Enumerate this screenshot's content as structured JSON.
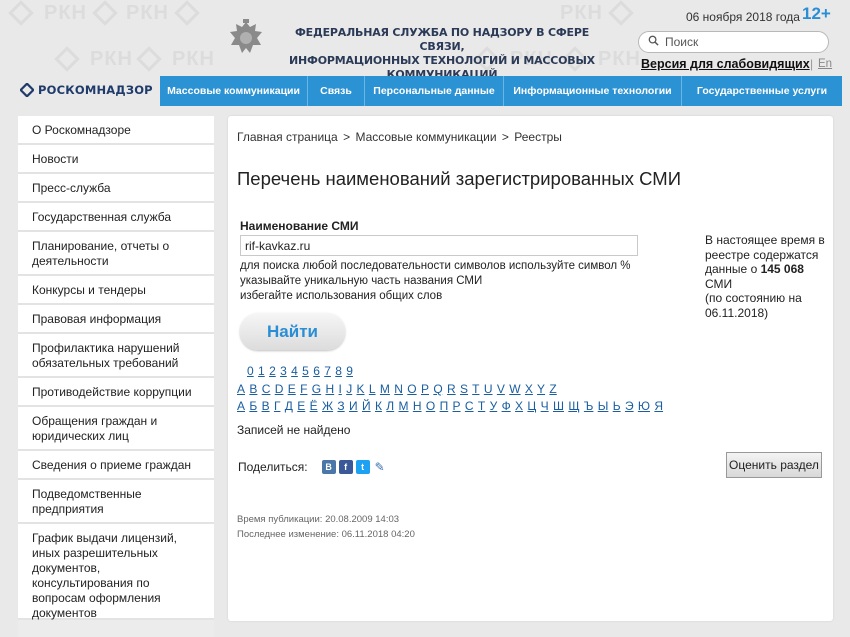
{
  "header": {
    "agency_line1": "ФЕДЕРАЛЬНАЯ СЛУЖБА ПО НАДЗОРУ В СФЕРЕ СВЯЗИ,",
    "agency_line2": "ИНФОРМАЦИОННЫХ ТЕХНОЛОГИЙ И МАССОВЫХ КОММУНИКАЦИЙ",
    "date": "06 ноября 2018 года",
    "age_rating": "12+",
    "search_placeholder": "Поиск",
    "accessibility_link": "Версия для слабовидящих",
    "separator": "|",
    "lang_link": "En",
    "logo_text": "РОСКОМНАДЗОР",
    "watermark": "РКН"
  },
  "nav": [
    {
      "label": "Массовые коммуникации"
    },
    {
      "label": "Связь"
    },
    {
      "label": "Персональные данные"
    },
    {
      "label": "Информационные технологии"
    },
    {
      "label": "Государственные услуги"
    }
  ],
  "sidebar": [
    {
      "label": "О Роскомнадзоре"
    },
    {
      "label": "Новости"
    },
    {
      "label": "Пресс-служба"
    },
    {
      "label": "Государственная служба"
    },
    {
      "label": "Планирование, отчеты о деятельности"
    },
    {
      "label": "Конкурсы и тендеры"
    },
    {
      "label": "Правовая информация"
    },
    {
      "label": "Профилактика нарушений обязательных требований"
    },
    {
      "label": "Противодействие коррупции"
    },
    {
      "label": "Обращения граждан и юридических лиц"
    },
    {
      "label": "Сведения о приеме граждан"
    },
    {
      "label": "Подведомственные предприятия"
    },
    {
      "label": "График выдачи лицензий, иных разрешительных документов, консультирования по вопросам оформления документов"
    }
  ],
  "main": {
    "breadcrumb": [
      "Главная страница",
      "Массовые коммуникации",
      "Реестры"
    ],
    "breadcrumb_sep": ">",
    "title": "Перечень наименований зарегистрированных СМИ",
    "field_label": "Наименование СМИ",
    "field_value": "rif-kavkaz.ru",
    "hint1": "для поиска любой последовательности символов используйте символ %",
    "hint2": "указывайте уникальную часть названия СМИ",
    "hint3": "избегайте использования общих слов",
    "find_button": "Найти",
    "stats_line1": "В настоящее время в",
    "stats_line2": "реестре содержатся",
    "stats_line3_prefix": "данные о ",
    "stats_count": "145 068",
    "stats_line4": "СМИ",
    "stats_line5": "(по состоянию на",
    "stats_line6": "06.11.2018)",
    "digits": [
      "0",
      "1",
      "2",
      "3",
      "4",
      "5",
      "6",
      "7",
      "8",
      "9"
    ],
    "latin": [
      "A",
      "B",
      "C",
      "D",
      "E",
      "F",
      "G",
      "H",
      "I",
      "J",
      "K",
      "L",
      "M",
      "N",
      "O",
      "P",
      "Q",
      "R",
      "S",
      "T",
      "U",
      "V",
      "W",
      "X",
      "Y",
      "Z"
    ],
    "cyrillic": [
      "А",
      "Б",
      "В",
      "Г",
      "Д",
      "Е",
      "Ё",
      "Ж",
      "З",
      "И",
      "Й",
      "К",
      "Л",
      "М",
      "Н",
      "О",
      "П",
      "Р",
      "С",
      "Т",
      "У",
      "Ф",
      "Х",
      "Ц",
      "Ч",
      "Ш",
      "Щ",
      "Ъ",
      "Ы",
      "Ь",
      "Э",
      "Ю",
      "Я"
    ],
    "no_results": "Записей не найдено",
    "share_label": "Поделиться:",
    "rate_button": "Оценить раздел",
    "published": "Время публикации: 20.08.2009 14:03",
    "modified": "Последнее изменение: 06.11.2018 04:20"
  },
  "colors": {
    "nav_bg": "#2b92d3",
    "link": "#1a5ea0",
    "accent": "#2a8ed4"
  }
}
